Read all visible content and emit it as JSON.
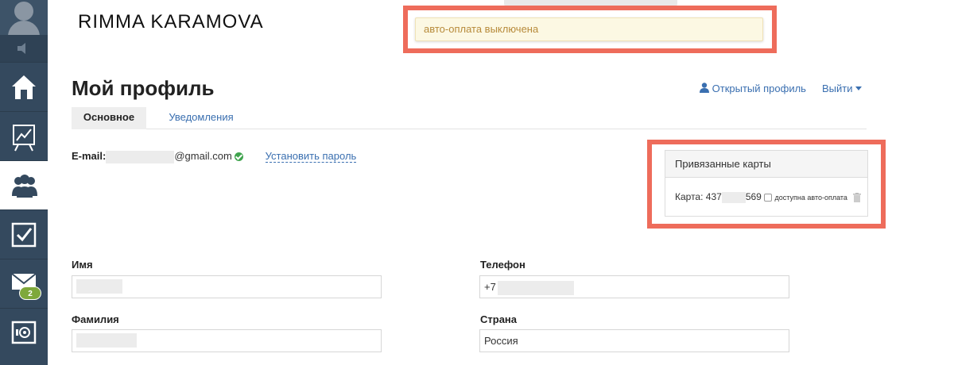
{
  "brand": {
    "name": "RIMMA KARAMOVA"
  },
  "alert": {
    "text": "авто-оплата выключена"
  },
  "header": {
    "title": "Мой профиль",
    "open_profile": "Открытый профиль",
    "logout": "Выйти"
  },
  "tabs": [
    {
      "label": "Основное",
      "active": true
    },
    {
      "label": "Уведомления",
      "active": false
    }
  ],
  "email": {
    "label": "E-mail:",
    "domain": "@gmail.com",
    "set_password": "Установить пароль"
  },
  "cards": {
    "title": "Привязанные карты",
    "card_prefix": "Карта: 437",
    "card_suffix": "569",
    "autopay_label": "доступна авто-оплата"
  },
  "form": {
    "first_name_label": "Имя",
    "last_name_label": "Фамилия",
    "phone_label": "Телефон",
    "phone_prefix": "+7",
    "country_label": "Страна",
    "country_value": "Россия"
  },
  "sidebar": {
    "messages_badge": "2"
  },
  "colors": {
    "sidebar_bg": "#34495e",
    "highlight": "#ee6c5b",
    "link": "#3a6fb0",
    "alert_bg": "#fcf8e3",
    "alert_text": "#b78a3a",
    "badge": "#7ea83b",
    "success": "#3fa34d"
  }
}
